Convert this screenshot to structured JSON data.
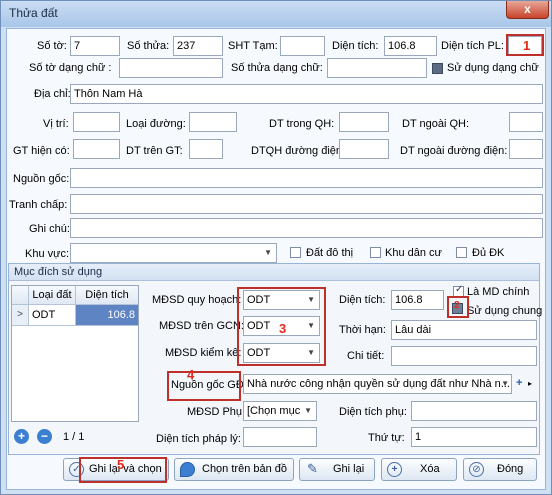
{
  "window": {
    "title": "Thửa đất",
    "close_glyph": "x"
  },
  "row1": {
    "so_to_label": "Số tờ:",
    "so_to_value": "7",
    "so_thua_label": "Số thửa:",
    "so_thua_value": "237",
    "sht_tam_label": "SHT Tạm:",
    "sht_tam_value": "",
    "dien_tich_label": "Diện tích:",
    "dien_tich_value": "106.8",
    "dien_tich_pl_label": "Diện tích PL:",
    "dien_tich_pl_value": ""
  },
  "row2": {
    "so_to_chu_label": "Số tờ dạng chữ :",
    "so_to_chu_value": "",
    "so_thua_chu_label": "Số thửa dạng chữ:",
    "so_thua_chu_value": "",
    "su_dung_dang_chu_label": "Sử dụng dạng chữ"
  },
  "row3": {
    "dia_chi_label": "Địa chỉ:",
    "dia_chi_value": "Thôn Nam Hà"
  },
  "row4": {
    "vi_tri_label": "Vị trí:",
    "loai_duong_label": "Loại đường:",
    "dt_trong_qh_label": "DT trong QH:",
    "dt_ngoai_qh_label": "DT ngoài QH:"
  },
  "row5": {
    "gt_hien_co_label": "GT hiện có:",
    "dt_tren_gt_label": "DT trên GT:",
    "dtqh_duong_dien_label": "DTQH đường điện:",
    "dt_ngoai_duong_dien_label": "DT ngoài đường điện:"
  },
  "row6": {
    "nguon_goc_label": "Nguồn gốc:"
  },
  "row7": {
    "tranh_chap_label": "Tranh chấp:"
  },
  "row8": {
    "ghi_chu_label": "Ghi chú:"
  },
  "row9": {
    "khu_vuc_label": "Khu vực:",
    "khu_vuc_value": "",
    "dat_do_thi_label": "Đất đô thị",
    "khu_dan_cu_label": "Khu dân cư",
    "du_dk_label": "Đủ ĐK"
  },
  "group": {
    "title": "Mục đích sử dụng"
  },
  "grid": {
    "col_loai_dat": "Loại đất",
    "col_dien_tich": "Diện tích",
    "rows": [
      {
        "loai_dat": "ODT",
        "dien_tich": "106.8"
      }
    ],
    "row_marker": ">"
  },
  "detail": {
    "mdsd_quy_hoach_label": "MĐSD quy hoạch:",
    "mdsd_quy_hoach_value": "ODT",
    "mdsd_tren_gcn_label": "MĐSD trên GCN:",
    "mdsd_tren_gcn_value": "ODT",
    "mdsd_kiem_ke_label": "MĐSD kiểm kê:",
    "mdsd_kiem_ke_value": "ODT",
    "dien_tich_label": "Diện tích:",
    "dien_tich_value": "106.8",
    "la_md_chinh_label": "Là MD chính",
    "su_dung_chung_label": "Sử dụng chung",
    "thoi_han_label": "Thời hạn:",
    "thoi_han_value": "Lâu dài",
    "chi_tiet_label": "Chi tiết:",
    "chi_tiet_value": "",
    "nguon_goc_gd_label": "Nguồn gốc GĐ:",
    "nguon_goc_gd_value": "Nhà nước công nhận quyền sử dụng đất như Nhà n...",
    "mdsd_phu_label": "MĐSD Phụ:",
    "mdsd_phu_value": "[Chọn mục",
    "dien_tich_phu_label": "Diện tích phụ:",
    "dien_tich_phu_value": "",
    "dien_tich_phap_ly_label": "Diện tích pháp lý:",
    "dien_tich_phap_ly_value": "",
    "thu_tu_label": "Thứ tự:",
    "thu_tu_value": "1"
  },
  "nav": {
    "page_text": "1 / 1"
  },
  "buttons": {
    "ghi_lai_va_chon": "Ghi lại và chọn",
    "chon_tren_ban_do": "Chọn trên bản đồ",
    "ghi_lai": "Ghi lại",
    "xoa": "Xóa",
    "dong": "Đóng"
  },
  "markers": {
    "m1": "1",
    "m2": "2",
    "m3": "3",
    "m4": "4",
    "m5": "5"
  },
  "colors": {
    "annotation_red": "#c0302a"
  }
}
